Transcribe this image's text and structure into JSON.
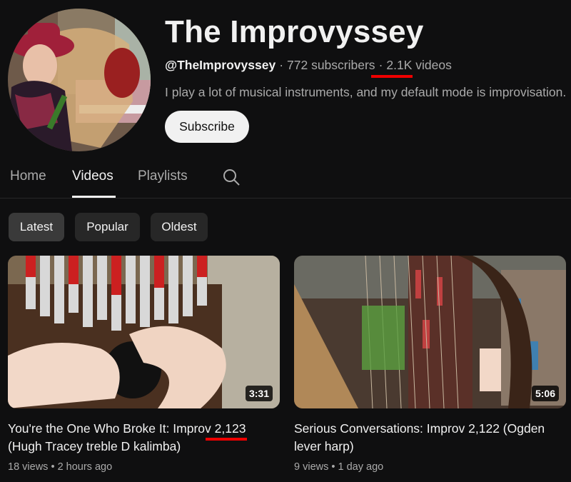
{
  "channel": {
    "name": "The Improvyssey",
    "handle": "@TheImprovyssey",
    "subscribers": "772 subscribers",
    "videos": "2.1K videos",
    "separator": "·",
    "description": "I play a lot of musical instruments, and my default mode is improvisation.",
    "subscribe_label": "Subscribe"
  },
  "tabs": [
    {
      "label": "Home"
    },
    {
      "label": "Videos"
    },
    {
      "label": "Playlists"
    }
  ],
  "filters": [
    {
      "label": "Latest"
    },
    {
      "label": "Popular"
    },
    {
      "label": "Oldest"
    }
  ],
  "videos": [
    {
      "title_line1": "You're the One Who Broke It: Improv 2,123",
      "title_line2": "(Hugh Tracey treble D kalimba)",
      "duration": "3:31",
      "views": "18 views",
      "age": "2 hours ago"
    },
    {
      "title_line1": "Serious Conversations: Improv 2,122 (Ogden",
      "title_line2": "lever harp)",
      "duration": "5:06",
      "views": "9 views",
      "age": "1 day ago"
    }
  ],
  "meta_dot": "•",
  "colors": {
    "background": "#0f0f10",
    "annotation_red": "#ee0000",
    "subscribe_bg": "#f1f1f1"
  },
  "icons": {
    "search": "search-icon"
  }
}
